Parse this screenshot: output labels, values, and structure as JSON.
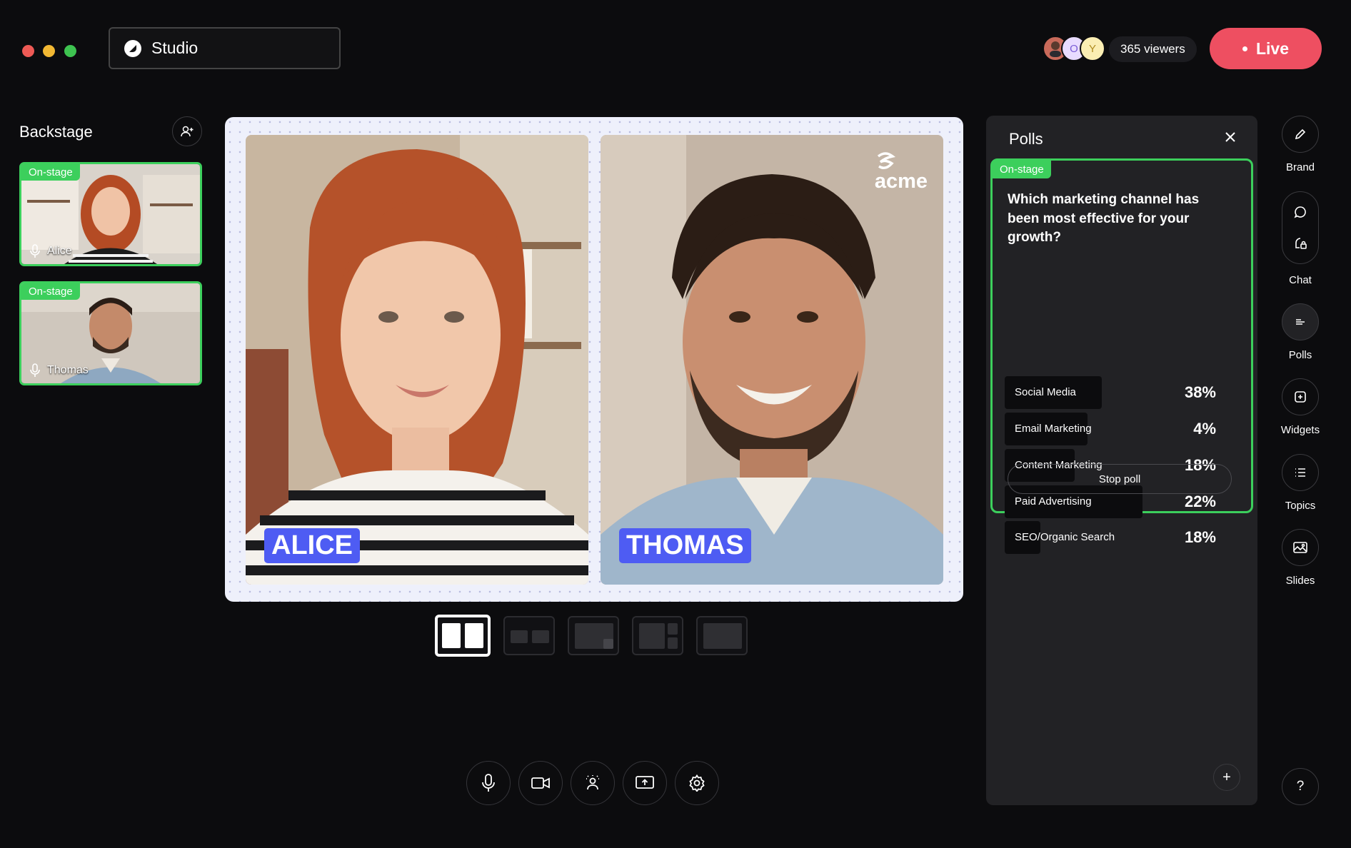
{
  "window": {
    "title": "Studio"
  },
  "header": {
    "viewer_initials": [
      "",
      "O",
      "Y"
    ],
    "viewers": "365 viewers",
    "live_label": "Live"
  },
  "backstage": {
    "title": "Backstage",
    "participants": [
      {
        "badge": "On-stage",
        "name": "Alice"
      },
      {
        "badge": "On-stage",
        "name": "Thomas"
      }
    ]
  },
  "stage": {
    "tiles": [
      {
        "name": "ALICE"
      },
      {
        "name": "THOMAS"
      }
    ],
    "brand_logo": "acme"
  },
  "polls": {
    "title": "Polls",
    "badge": "On-stage",
    "question": "Which marketing channel has been most effective for your growth?",
    "options": [
      {
        "label": "Social Media",
        "percent": "38%",
        "value": 38
      },
      {
        "label": "Email Marketing",
        "percent": "4%",
        "value": 4
      },
      {
        "label": "Content Marketing",
        "percent": "18%",
        "value": 18
      },
      {
        "label": "Paid Advertising",
        "percent": "22%",
        "value": 22
      },
      {
        "label": "SEO/Organic Search",
        "percent": "18%",
        "value": 18
      }
    ],
    "stop_label": "Stop poll",
    "add_symbol": "+"
  },
  "rail": {
    "brand": "Brand",
    "chat": "Chat",
    "polls": "Polls",
    "widgets": "Widgets",
    "topics": "Topics",
    "slides": "Slides",
    "help": "?"
  },
  "colors": {
    "accent_green": "#3ccf5c",
    "live_red": "#ee4f61",
    "nametag_blue": "#4e5cf3"
  }
}
